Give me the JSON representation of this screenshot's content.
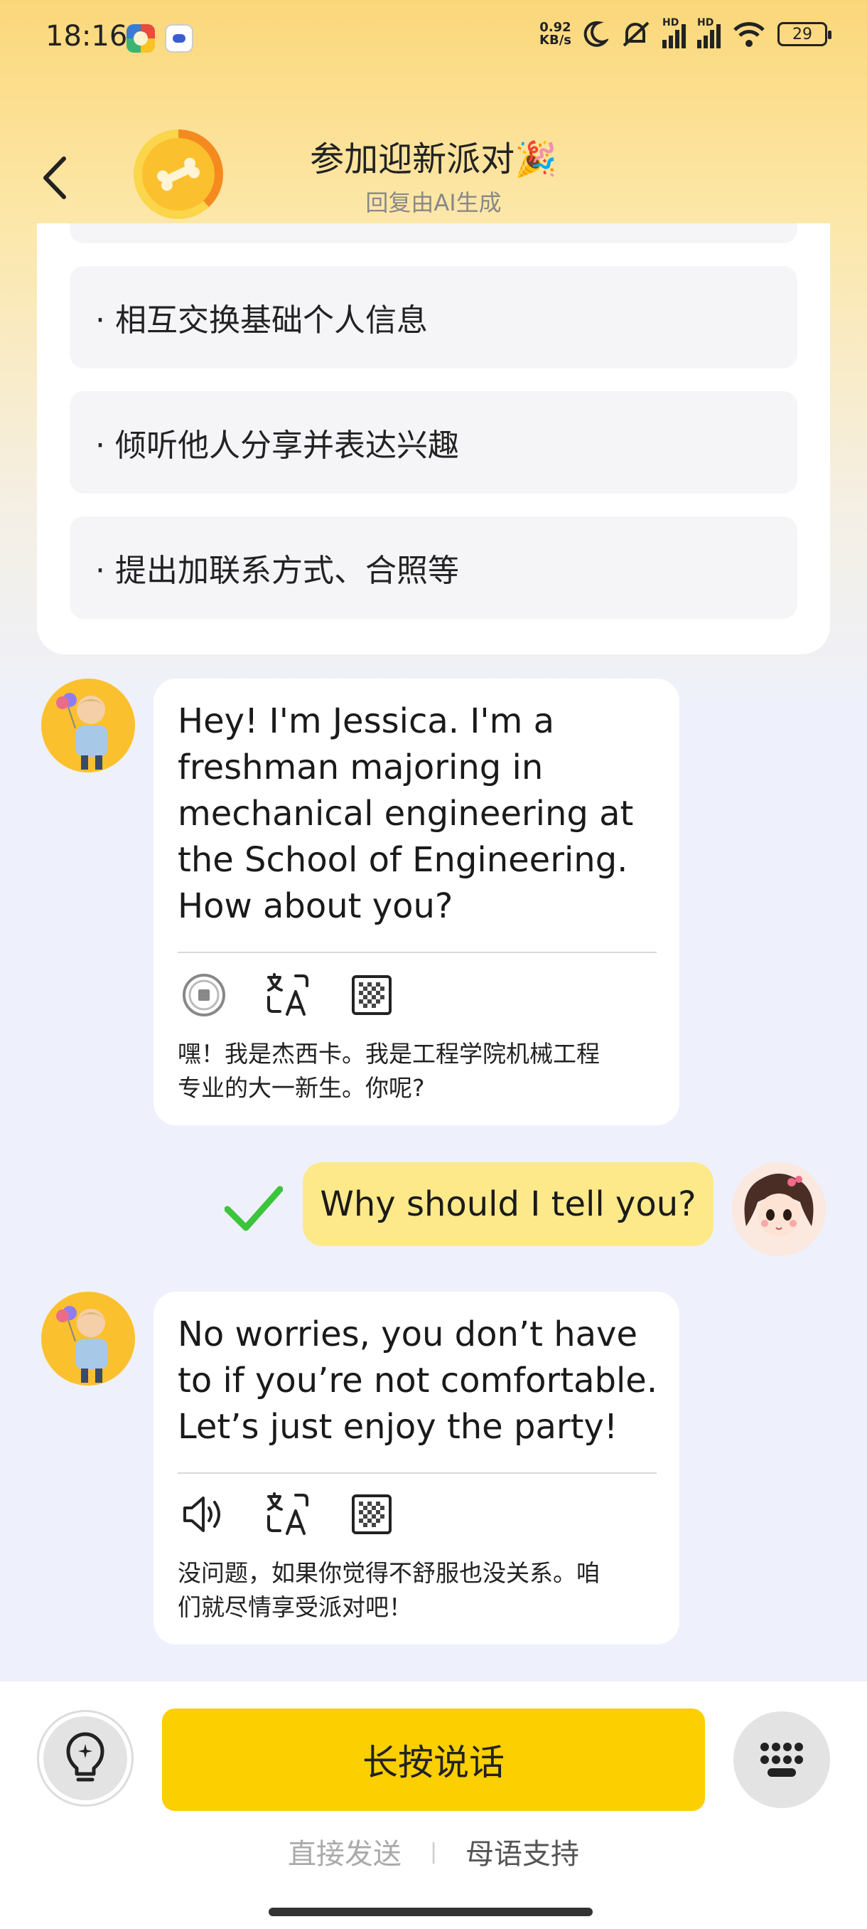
{
  "status_bar": {
    "time": "18:16",
    "net_speed_value": "0.92",
    "net_speed_unit": "KB/s",
    "signal1_label": "HD",
    "signal2_label": "HD",
    "battery": "29"
  },
  "header": {
    "title": "参加迎新派对🎉",
    "subtitle": "回复由AI生成",
    "progress": 0.38
  },
  "task_card": {
    "items": [
      "· 相互交换基础个人信息",
      "· 倾听他人分享并表达兴趣",
      "· 提出加联系方式、合照等"
    ]
  },
  "messages": [
    {
      "sender": "bot",
      "text_lines": [
        "Hey! I'm Jessica. I'm a",
        "freshman majoring in",
        "mechanical engineering at",
        "the School of Engineering.",
        "How about you?"
      ],
      "translation_lines": [
        "嘿！我是杰西卡。我是工程学院机械工程",
        "专业的大一新生。你呢?"
      ],
      "tools": [
        "stop-icon",
        "translate-icon",
        "grid-icon"
      ]
    },
    {
      "sender": "user",
      "text": "Why should I tell you?",
      "status": "check-icon"
    },
    {
      "sender": "bot",
      "text_lines": [
        "No worries, you don’t have",
        "to if you’re not comfortable.",
        "Let’s just enjoy the party!"
      ],
      "translation_lines": [
        "没问题，如果你觉得不舒服也没关系。咱",
        "们就尽情享受派对吧！"
      ],
      "tools": [
        "speaker-icon",
        "translate-icon",
        "grid-icon"
      ]
    }
  ],
  "bottom": {
    "talk_label": "长按说话",
    "direct_send": "直接发送",
    "separator": "|",
    "native_support": "母语支持"
  },
  "colors": {
    "accent": "#fccf00",
    "user_bubble": "#fde98a",
    "check": "#3cc43c"
  }
}
